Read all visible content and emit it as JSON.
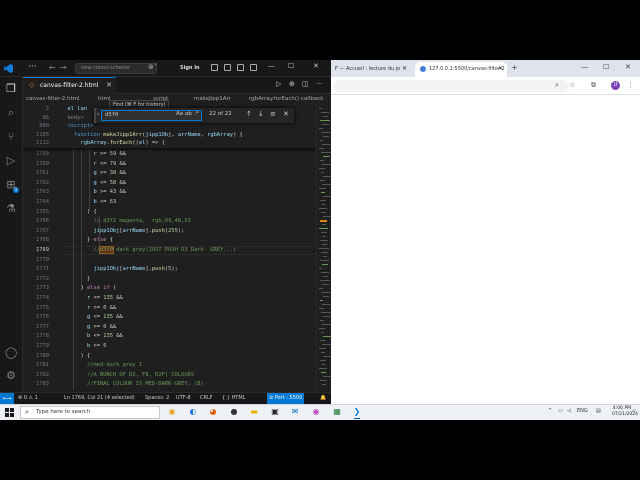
{
  "vscode": {
    "title": {
      "search_placeholder": "new-colour-scheme",
      "sign_in": "Sign In"
    },
    "tab": {
      "label": "canvas-filter-2.html"
    },
    "breadcrumbs": [
      "canvas-filter-2.html",
      "html",
      "script",
      "makeJipp1Arr",
      "rgbArray.forEach() callback"
    ],
    "tooltip": "Find (⌘ F for history)",
    "find": {
      "query": "d3f0",
      "case_label": "Aa",
      "word_label": "ab",
      "regex_label": ".*",
      "count": "22 of 22"
    },
    "sticky_lines": [
      {
        "ln": "2",
        "tokens": [
          {
            "t": "  el lan",
            "c": "v"
          }
        ]
      },
      {
        "ln": "86",
        "tokens": [
          {
            "t": "  body>",
            "c": "t"
          }
        ]
      },
      {
        "ln": "880",
        "tokens": [
          {
            "t": "  <script>",
            "c": "k"
          }
        ]
      },
      {
        "ln": "1105",
        "tokens": [
          {
            "t": "    function ",
            "c": "k"
          },
          {
            "t": "makeJipp1Arr",
            "c": "f"
          },
          {
            "t": "(",
            "c": "p"
          },
          {
            "t": "jipp1Obj",
            "c": "v"
          },
          {
            "t": ", ",
            "c": "p"
          },
          {
            "t": "arrName",
            "c": "v"
          },
          {
            "t": ", ",
            "c": "p"
          },
          {
            "t": "rgbArray",
            "c": "v"
          },
          {
            "t": ") {",
            "c": "p"
          }
        ]
      },
      {
        "ln": "1112",
        "tokens": [
          {
            "t": "      rgbArray",
            "c": "v"
          },
          {
            "t": ".",
            "c": "p"
          },
          {
            "t": "forEach",
            "c": "f"
          },
          {
            "t": "((",
            "c": "p"
          },
          {
            "t": "el",
            "c": "v"
          },
          {
            "t": ") => {",
            "c": "p"
          }
        ]
      }
    ],
    "lines": [
      {
        "ln": "1759",
        "tokens": [
          {
            "t": "          r ",
            "c": "v"
          },
          {
            "t": ">= ",
            "c": "p"
          },
          {
            "t": "59",
            "c": "n"
          },
          {
            "t": " &&",
            "c": "p"
          }
        ]
      },
      {
        "ln": "1760",
        "tokens": [
          {
            "t": "          r ",
            "c": "v"
          },
          {
            "t": "<= ",
            "c": "p"
          },
          {
            "t": "79",
            "c": "n"
          },
          {
            "t": " &&",
            "c": "p"
          }
        ]
      },
      {
        "ln": "1761",
        "tokens": [
          {
            "t": "          g ",
            "c": "v"
          },
          {
            "t": ">= ",
            "c": "p"
          },
          {
            "t": "38",
            "c": "n"
          },
          {
            "t": " &&",
            "c": "p"
          }
        ]
      },
      {
        "ln": "1762",
        "tokens": [
          {
            "t": "          g ",
            "c": "v"
          },
          {
            "t": "<= ",
            "c": "p"
          },
          {
            "t": "58",
            "c": "n"
          },
          {
            "t": " &&",
            "c": "p"
          }
        ]
      },
      {
        "ln": "1763",
        "tokens": [
          {
            "t": "          b ",
            "c": "v"
          },
          {
            "t": ">= ",
            "c": "p"
          },
          {
            "t": "43",
            "c": "n"
          },
          {
            "t": " &&",
            "c": "p"
          }
        ]
      },
      {
        "ln": "1764",
        "tokens": [
          {
            "t": "          b ",
            "c": "v"
          },
          {
            "t": "<= ",
            "c": "p"
          },
          {
            "t": "63",
            "c": "n"
          }
        ]
      },
      {
        "ln": "1765",
        "tokens": [
          {
            "t": "        ) {",
            "c": "p"
          }
        ]
      },
      {
        "ln": "1766",
        "tokens": [
          {
            "t": "          // d3f2 magenta,  rgb,69,48,53",
            "c": "m"
          }
        ]
      },
      {
        "ln": "1767",
        "tokens": [
          {
            "t": "          jipp1Obj",
            "c": "v"
          },
          {
            "t": "[",
            "c": "p"
          },
          {
            "t": "arrName",
            "c": "v"
          },
          {
            "t": "].",
            "c": "p"
          },
          {
            "t": "push",
            "c": "f"
          },
          {
            "t": "(",
            "c": "p"
          },
          {
            "t": "255",
            "c": "n"
          },
          {
            "t": ");",
            "c": "p"
          }
        ]
      },
      {
        "ln": "1768",
        "tokens": [
          {
            "t": "        } ",
            "c": "p"
          },
          {
            "t": "else",
            "c": "c"
          },
          {
            "t": " {",
            "c": "p"
          }
        ]
      },
      {
        "ln": "1769",
        "current": true,
        "tokens": [
          {
            "t": "          //",
            "c": "m"
          },
          {
            "t": "d3f0",
            "c": "m",
            "hl": true
          },
          {
            "t": " dark grey(JUST PUSH D3 Dark  GREY...)",
            "c": "m"
          }
        ]
      },
      {
        "ln": "1770",
        "tokens": []
      },
      {
        "ln": "1771",
        "tokens": [
          {
            "t": "          jipp1Obj",
            "c": "v"
          },
          {
            "t": "[",
            "c": "p"
          },
          {
            "t": "arrName",
            "c": "v"
          },
          {
            "t": "].",
            "c": "p"
          },
          {
            "t": "push",
            "c": "f"
          },
          {
            "t": "(",
            "c": "p"
          },
          {
            "t": "5",
            "c": "n"
          },
          {
            "t": ");",
            "c": "p"
          }
        ]
      },
      {
        "ln": "1772",
        "tokens": [
          {
            "t": "        }",
            "c": "p"
          }
        ]
      },
      {
        "ln": "1773",
        "tokens": [
          {
            "t": "      } ",
            "c": "p"
          },
          {
            "t": "else if",
            "c": "c"
          },
          {
            "t": " (",
            "c": "p"
          }
        ]
      },
      {
        "ln": "1774",
        "tokens": [
          {
            "t": "        r ",
            "c": "v"
          },
          {
            "t": "<= ",
            "c": "p"
          },
          {
            "t": "135",
            "c": "n"
          },
          {
            "t": " &&",
            "c": "p"
          }
        ]
      },
      {
        "ln": "1775",
        "tokens": [
          {
            "t": "        r ",
            "c": "v"
          },
          {
            "t": ">= ",
            "c": "p"
          },
          {
            "t": "0",
            "c": "n"
          },
          {
            "t": " &&",
            "c": "p"
          }
        ]
      },
      {
        "ln": "1776",
        "tokens": [
          {
            "t": "        g ",
            "c": "v"
          },
          {
            "t": "<= ",
            "c": "p"
          },
          {
            "t": "135",
            "c": "n"
          },
          {
            "t": " &&",
            "c": "p"
          }
        ]
      },
      {
        "ln": "1777",
        "tokens": [
          {
            "t": "        g ",
            "c": "v"
          },
          {
            "t": ">= ",
            "c": "p"
          },
          {
            "t": "0",
            "c": "n"
          },
          {
            "t": " &&",
            "c": "p"
          }
        ]
      },
      {
        "ln": "1778",
        "tokens": [
          {
            "t": "        b ",
            "c": "v"
          },
          {
            "t": "<= ",
            "c": "p"
          },
          {
            "t": "135",
            "c": "n"
          },
          {
            "t": " &&",
            "c": "p"
          }
        ]
      },
      {
        "ln": "1779",
        "tokens": [
          {
            "t": "        b ",
            "c": "v"
          },
          {
            "t": ">= ",
            "c": "p"
          },
          {
            "t": "0",
            "c": "n"
          }
        ]
      },
      {
        "ln": "1780",
        "tokens": [
          {
            "t": "      ) {",
            "c": "p"
          }
        ]
      },
      {
        "ln": "1781",
        "tokens": [
          {
            "t": "        //med-dark grey 1",
            "c": "m"
          }
        ]
      },
      {
        "ln": "1782",
        "tokens": [
          {
            "t": "        //A BUNCH OF D2, F8, D2F) COLOURS",
            "c": "m"
          }
        ]
      },
      {
        "ln": "1783",
        "tokens": [
          {
            "t": "        //FINAL COLOUR IS MED-DARK-GREY, (8)",
            "c": "m"
          }
        ]
      }
    ],
    "status": {
      "remote": "⟷",
      "problems": "⊗ 0 ⚠ 1",
      "position": "Ln 1769, Col 21 (4 selected)",
      "spaces": "Spaces: 2",
      "encoding": "UTF-8",
      "eol": "CRLF",
      "language": "{ } HTML",
      "port": "⊘ Port : 5500"
    }
  },
  "browser": {
    "tabs": [
      {
        "label": "F — Accueil : lecture du jo",
        "active": false
      },
      {
        "label": "127.0.0.1:5500/canvas-filter-2",
        "active": true
      }
    ]
  },
  "taskbar": {
    "search_placeholder": "Type here to search",
    "language": "ENG",
    "time": "4:06 PM",
    "date": "07/21/2024"
  },
  "colors": {
    "accent": "#0078d4",
    "editor_bg": "#1f1f1f",
    "find_highlight": "#613214"
  }
}
